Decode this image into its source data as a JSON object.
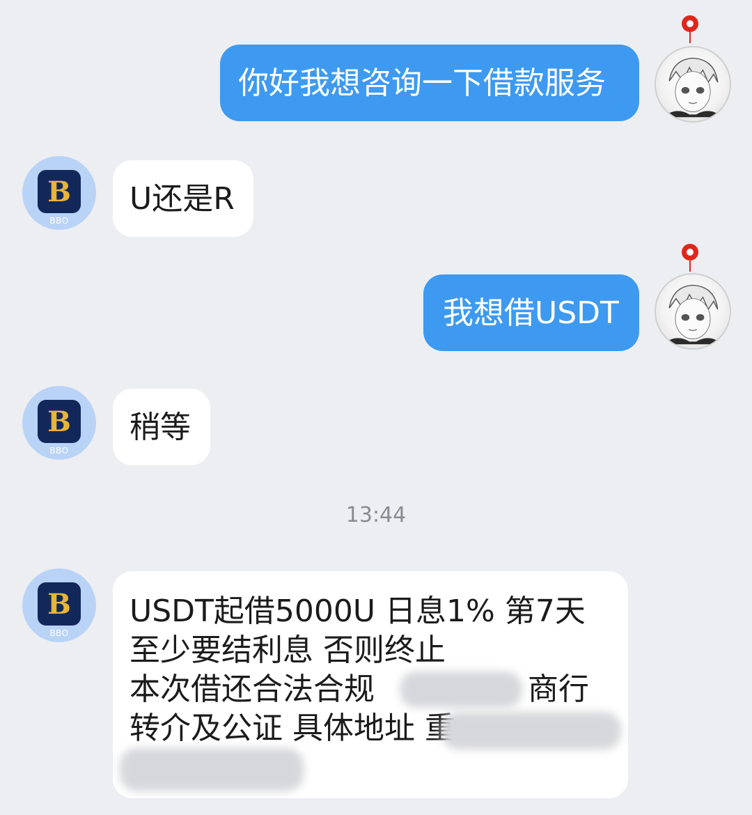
{
  "messages": [
    {
      "side": "out",
      "text": "你好我想咨询一下借款服务"
    },
    {
      "side": "in",
      "avatar_label": "BBO",
      "avatar_letter": "B",
      "text": "U还是R"
    },
    {
      "side": "out",
      "text": "我想借USDT"
    },
    {
      "side": "in",
      "avatar_label": "BBO",
      "avatar_letter": "B",
      "text": "稍等"
    },
    {
      "side": "in",
      "avatar_label": "BBO",
      "avatar_letter": "B",
      "lines": [
        "USDT起借5000U  日息1% 第7天",
        "至少要结利息 否则终止",
        "本次借还合法合规 ",
        "转介及公证 具体地址",
        ""
      ],
      "visible_fragments": {
        "line3_tail": "商行",
        "line4_tail": "重"
      }
    }
  ],
  "timestamp": "13:44",
  "colors": {
    "background": "#edeef2",
    "outgoing_bubble": "#3d9af0",
    "incoming_bubble": "#ffffff",
    "bbo_tile": "#13285a",
    "bbo_letter": "#e8b53b"
  }
}
